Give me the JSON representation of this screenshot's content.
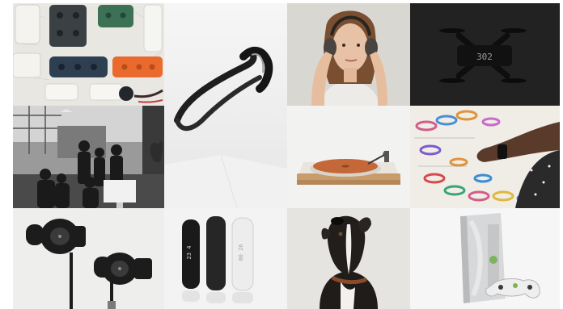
{
  "gallery": {
    "tiles": [
      {
        "subject": "power-strips"
      },
      {
        "subject": "headset-band"
      },
      {
        "subject": "woman-with-headphones"
      },
      {
        "subject": "drone"
      },
      {
        "subject": "studio-team"
      },
      {
        "subject": "turntable"
      },
      {
        "subject": "wristband-sketches"
      },
      {
        "subject": "earbuds"
      },
      {
        "subject": "fitness-bands"
      },
      {
        "subject": "dog"
      },
      {
        "subject": "game-console"
      }
    ],
    "texts": {
      "drone_display": "302",
      "band_black": "23 4",
      "band_white": "00 26"
    }
  }
}
